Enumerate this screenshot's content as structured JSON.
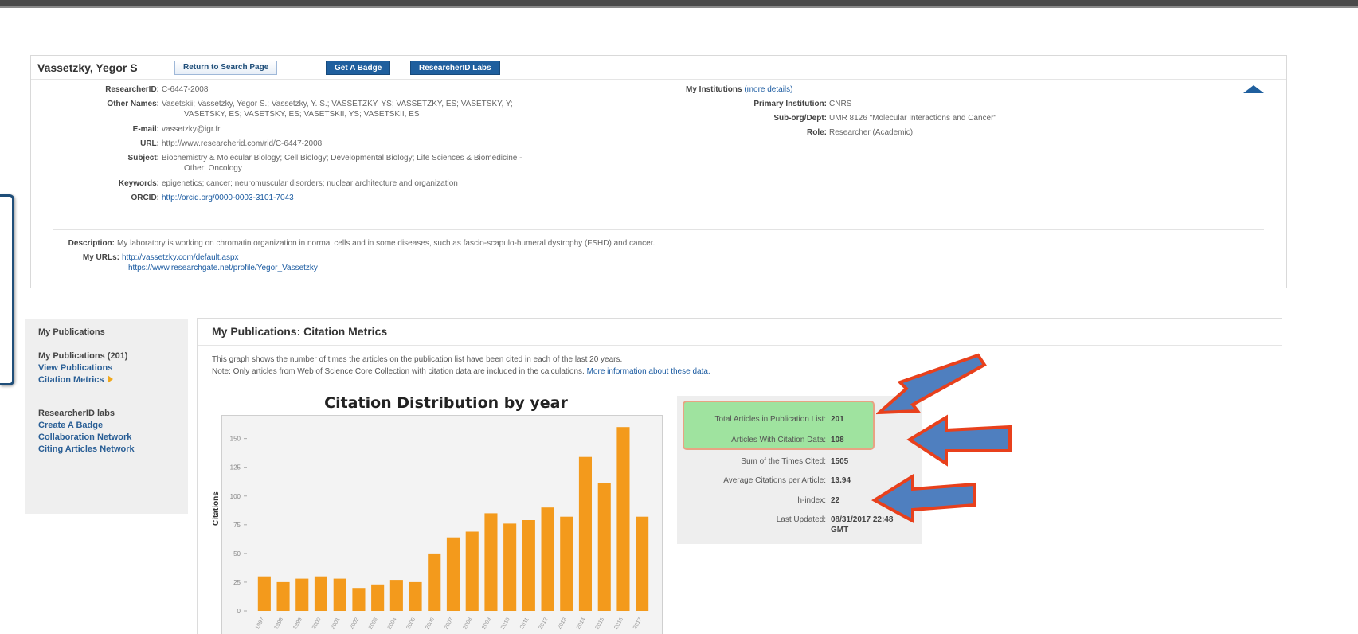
{
  "profile": {
    "name": "Vassetzky, Yegor S",
    "return_button": "Return to Search Page",
    "badge_button": "Get A Badge",
    "labs_button": "ResearcherID Labs",
    "researcher_id_label": "ResearcherID:",
    "researcher_id": "C-6447-2008",
    "other_names_label": "Other Names:",
    "other_names_line1": "Vasetskii; Vassetzky, Yegor S.; Vassetzky, Y. S.; VASSETZKY, YS; VASSETZKY, ES; VASETSKY, Y;",
    "other_names_line2": "VASETSKY, ES; VASETSKY, ES; VASETSKII, YS; VASETSKII, ES",
    "email_label": "E-mail:",
    "email": "vassetzky@igr.fr",
    "url_label": "URL:",
    "url": "http://www.researcherid.com/rid/C-6447-2008",
    "subject_label": "Subject:",
    "subject_line1": "Biochemistry & Molecular Biology; Cell Biology; Developmental Biology; Life Sciences & Biomedicine -",
    "subject_line2": "Other; Oncology",
    "keywords_label": "Keywords:",
    "keywords": "epigenetics; cancer; neuromuscular disorders; nuclear architecture and organization",
    "orcid_label": "ORCID:",
    "orcid": "http://orcid.org/0000-0003-3101-7043",
    "institutions_label": "My Institutions",
    "institutions_link": "(more details)",
    "primary_label": "Primary Institution:",
    "primary": "CNRS",
    "suborg_label": "Sub-org/Dept:",
    "suborg": "UMR 8126 \"Molecular Interactions and Cancer\"",
    "role_label": "Role:",
    "role": "Researcher (Academic)",
    "description_label": "Description:",
    "description": "My laboratory is working on chromatin organization in normal cells and in some diseases, such as fascio-scapulo-humeral dystrophy (FSHD) and cancer.",
    "urls_label": "My URLs:",
    "url1": "http://vassetzky.com/default.aspx",
    "url2": "https://www.researchgate.net/profile/Yegor_Vassetzky"
  },
  "nav": {
    "title": "My Publications",
    "publications": "My Publications (201)",
    "view": "View Publications",
    "metrics": "Citation Metrics",
    "labs_title": "ResearcherID labs",
    "badge": "Create A Badge",
    "collab": "Collaboration Network",
    "citing": "Citing Articles Network"
  },
  "main": {
    "title": "My Publications: Citation Metrics",
    "intro1": "This graph shows the number of times the articles on the publication list have been cited in each of the last 20 years.",
    "intro2": "Note: Only articles from Web of Science Core Collection with citation data are included in the calculations.",
    "intro2_link": "More information about these data."
  },
  "stats": {
    "total_label": "Total Articles in Publication List:",
    "total": "201",
    "with_data_label": "Articles With Citation Data:",
    "with_data": "108",
    "sum_label": "Sum of the Times Cited:",
    "sum": "1505",
    "avg_label": "Average Citations per Article:",
    "avg": "13.94",
    "h_label": "h-index:",
    "h": "22",
    "updated_label": "Last Updated:",
    "updated": "08/31/2017 22:48",
    "updated_tz": "GMT"
  },
  "colors": {
    "bar": "#f39a1c",
    "link": "#1a5aa0",
    "button": "#1f5f9e",
    "highlight": "#9fe39f",
    "arrow_fill": "#4f7fbf",
    "arrow_stroke": "#e8401c"
  },
  "chart_data": {
    "type": "bar",
    "title": "Citation Distribution by year",
    "ylabel": "Citations",
    "ylim": [
      0,
      165
    ],
    "yticks": [
      0,
      25,
      50,
      75,
      100,
      125,
      150
    ],
    "categories": [
      "1997",
      "1998",
      "1999",
      "2000",
      "2001",
      "2002",
      "2003",
      "2004",
      "2005",
      "2006",
      "2007",
      "2008",
      "2009",
      "2010",
      "2011",
      "2012",
      "2013",
      "2014",
      "2015",
      "2016",
      "2017"
    ],
    "values": [
      30,
      25,
      28,
      30,
      28,
      20,
      23,
      27,
      25,
      50,
      64,
      69,
      85,
      76,
      79,
      90,
      82,
      134,
      111,
      160,
      82
    ]
  }
}
